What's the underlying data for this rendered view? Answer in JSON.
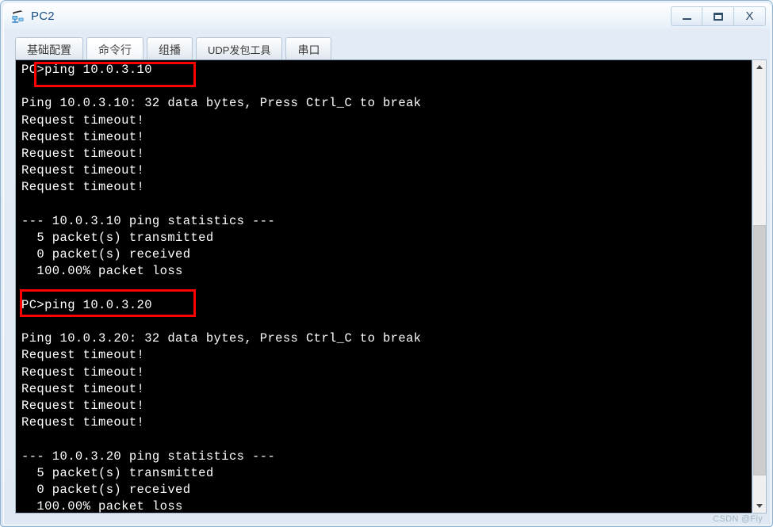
{
  "window": {
    "title": "PC2",
    "icon": "pc-network-icon",
    "controls": {
      "minimize": "–",
      "maximize": "☐",
      "close": "X"
    }
  },
  "tabs": [
    {
      "label": "基础配置",
      "active": false
    },
    {
      "label": "命令行",
      "active": true
    },
    {
      "label": "组播",
      "active": false
    },
    {
      "label": "UDP发包工具",
      "active": false
    },
    {
      "label": "串口",
      "active": false
    }
  ],
  "terminal": {
    "lines": [
      "PC>ping 10.0.3.10",
      "",
      "Ping 10.0.3.10: 32 data bytes, Press Ctrl_C to break",
      "Request timeout!",
      "Request timeout!",
      "Request timeout!",
      "Request timeout!",
      "Request timeout!",
      "",
      "--- 10.0.3.10 ping statistics ---",
      "  5 packet(s) transmitted",
      "  0 packet(s) received",
      "  100.00% packet loss",
      "",
      "PC>ping 10.0.3.20",
      "",
      "Ping 10.0.3.20: 32 data bytes, Press Ctrl_C to break",
      "Request timeout!",
      "Request timeout!",
      "Request timeout!",
      "Request timeout!",
      "Request timeout!",
      "",
      "--- 10.0.3.20 ping statistics ---",
      "  5 packet(s) transmitted",
      "  0 packet(s) received",
      "  100.00% packet loss"
    ],
    "text_color": "#ffffff",
    "background_color": "#000000",
    "annotations": [
      {
        "name": "highlight-ping-1",
        "target": "PC>ping 10.0.3.10",
        "color": "#ff0000"
      },
      {
        "name": "highlight-ping-2",
        "target": "PC>ping 10.0.3.20",
        "color": "#ff0000"
      }
    ]
  },
  "scrollbar": {
    "up_arrow": "˄",
    "down_arrow": "˅"
  },
  "watermark": {
    "text": "CSDN @Fiy"
  }
}
